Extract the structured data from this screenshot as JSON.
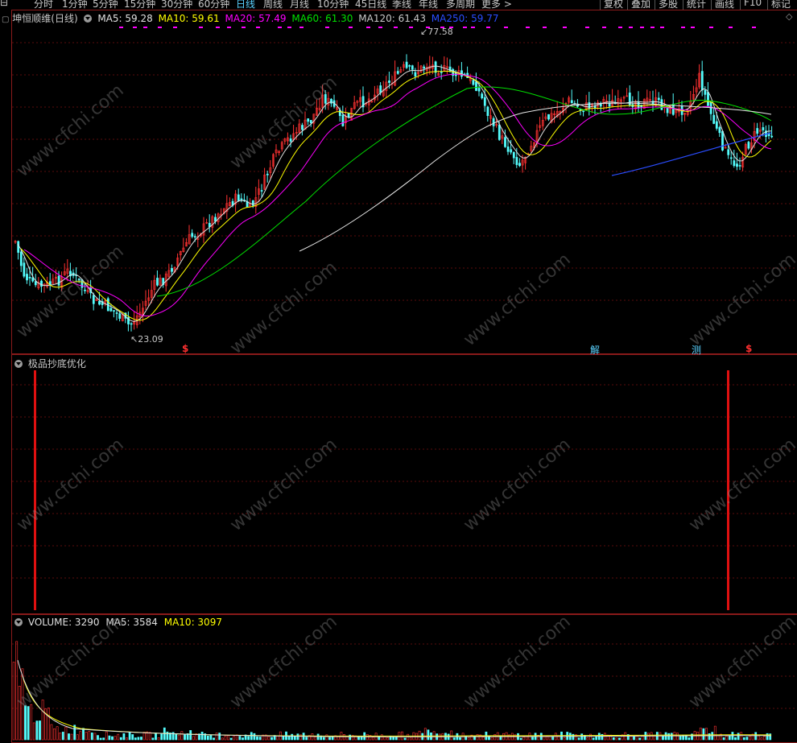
{
  "toolbar": {
    "periods": [
      "分时",
      "1分钟",
      "5分钟",
      "15分钟",
      "30分钟",
      "60分钟",
      "日线",
      "周线",
      "月线",
      "10分钟",
      "45日线",
      "季线",
      "年线",
      "多周期",
      "更多 >"
    ],
    "active_period": "日线",
    "right_buttons": [
      "复权",
      "叠加",
      "多股",
      "统计",
      "画线",
      "F10",
      "标记"
    ]
  },
  "main_panel": {
    "stock_label": "坤恒顺维(日线)",
    "ma": [
      {
        "name": "MA5:",
        "value": "59.28",
        "color": "#e0e0e0"
      },
      {
        "name": "MA10:",
        "value": "59.61",
        "color": "#ffff00"
      },
      {
        "name": "MA20:",
        "value": "57.49",
        "color": "#ff00ff"
      },
      {
        "name": "MA60:",
        "value": "61.30",
        "color": "#00e000"
      },
      {
        "name": "MA120:",
        "value": "61.43",
        "color": "#c8c8c8"
      },
      {
        "name": "MA250:",
        "value": "59.77",
        "color": "#2a4dff"
      }
    ],
    "high_label": "77.58",
    "low_label": "23.09",
    "signals": [
      {
        "text": "$",
        "color": "#ff3030"
      },
      {
        "text": "解",
        "color": "#5ad2ff"
      },
      {
        "text": "测",
        "color": "#5ad2ff"
      },
      {
        "text": "$",
        "color": "#ff3030"
      }
    ]
  },
  "indicator_panel": {
    "title": "极品抄底优化"
  },
  "volume_panel": {
    "items": [
      {
        "text": "VOLUME: 3290",
        "color": "#e0e0e0"
      },
      {
        "text": "MA5: 3584",
        "color": "#e0e0e0"
      },
      {
        "text": "MA10: 3097",
        "color": "#ffff00"
      }
    ]
  },
  "watermark": "www.cfchi.com",
  "colors": {
    "up": "#ff3232",
    "down": "#54fcfc",
    "border": "#8a1a1a",
    "grid": "#5a0c0c"
  }
}
